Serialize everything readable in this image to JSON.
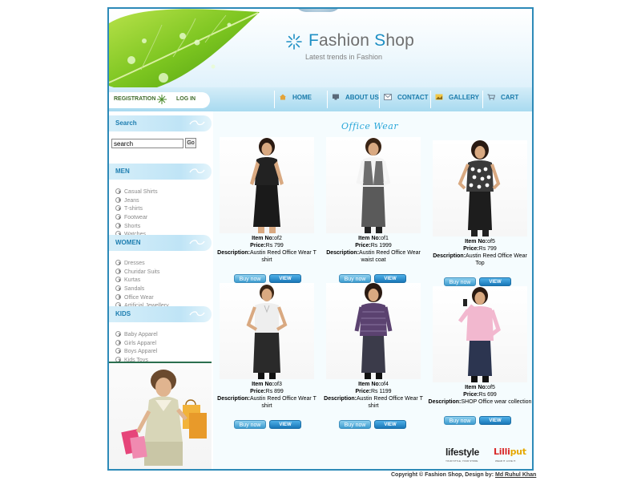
{
  "header": {
    "site_name_first_letter": "F",
    "site_name_rest_1": "ashion ",
    "site_name_second_letter": "S",
    "site_name_rest_2": "hop",
    "tagline": "Latest trends in Fashion"
  },
  "auth": {
    "registration": "REGISTRATION",
    "login": "LOG IN"
  },
  "nav": [
    {
      "label": "HOME",
      "icon": "home-icon"
    },
    {
      "label": "ABOUT US",
      "icon": "monitor-icon"
    },
    {
      "label": "CONTACT",
      "icon": "mail-icon"
    },
    {
      "label": "GALLERY",
      "icon": "image-icon"
    },
    {
      "label": "CART",
      "icon": "cart-icon"
    }
  ],
  "search": {
    "heading": "Search",
    "value": "search",
    "button": "Go"
  },
  "categories": {
    "men": {
      "heading": "MEN",
      "items": [
        "Casual Shirts",
        "Jeans",
        "T-shirts",
        "Footwear",
        "Shorts",
        "Watches"
      ]
    },
    "women": {
      "heading": "WOMEN",
      "items": [
        "Dresses",
        "Churidar Suits",
        "Kurtas",
        "Sandals",
        "Office Wear",
        "Artificial Jewellery"
      ]
    },
    "kids": {
      "heading": "KIDS",
      "items": [
        "Baby Apparel",
        "Girls Apparel",
        "Boys Apparel",
        "Kids Toys"
      ]
    }
  },
  "section_title": "Office Wear",
  "labels": {
    "item": "Item No:",
    "price": "Price:",
    "description": "Description:"
  },
  "buttons": {
    "buy": "Buy now",
    "view": "VIEW"
  },
  "products": [
    {
      "item_no": "of2",
      "price": "Rs 799",
      "description": "Austin Reed Office Wear T shirt",
      "top_color": "#222222",
      "bottom_color": "#1a1a1a"
    },
    {
      "item_no": "of1",
      "price": "Rs 1999",
      "description": "Austin Reed Office Wear waist coat",
      "top_color": "#6e6e6e",
      "bottom_color": "#5a5a5a"
    },
    {
      "item_no": "of5",
      "price": "Rs 799",
      "description": "Austin Reed Office Wear Top",
      "top_color": "#3a3a3a",
      "bottom_color": "#1d1d1d"
    },
    {
      "item_no": "of3",
      "price": "Rs 899",
      "description": "Austin Reed Office Wear T shirt",
      "top_color": "#eeeeee",
      "bottom_color": "#2a2a2a"
    },
    {
      "item_no": "of4",
      "price": "Rs 1199",
      "description": "Austin Reed Office Wear T shirt",
      "top_color": "#5b4270",
      "bottom_color": "#3b3b4a"
    },
    {
      "item_no": "of5",
      "price": "Rs 699",
      "description": "SHOP Office wear collection",
      "top_color": "#f2b8cf",
      "bottom_color": "#2c3550"
    }
  ],
  "brands": {
    "lifestyle": "lifestyle",
    "lifestyle_sub": "YOUR STYLE, YOUR STORE",
    "lilliput_a": "Lilli",
    "lilliput_b": "put",
    "lilliput_sub": "WEAR IT. LOVE IT."
  },
  "footer": {
    "text": "Copyright © Fashion Shop, Design by: ",
    "designer": "Md Ruhul Khan"
  },
  "colors": {
    "accent": "#1e8fc4",
    "frame": "#2d8ab8",
    "nav_text": "#1a7bab"
  }
}
